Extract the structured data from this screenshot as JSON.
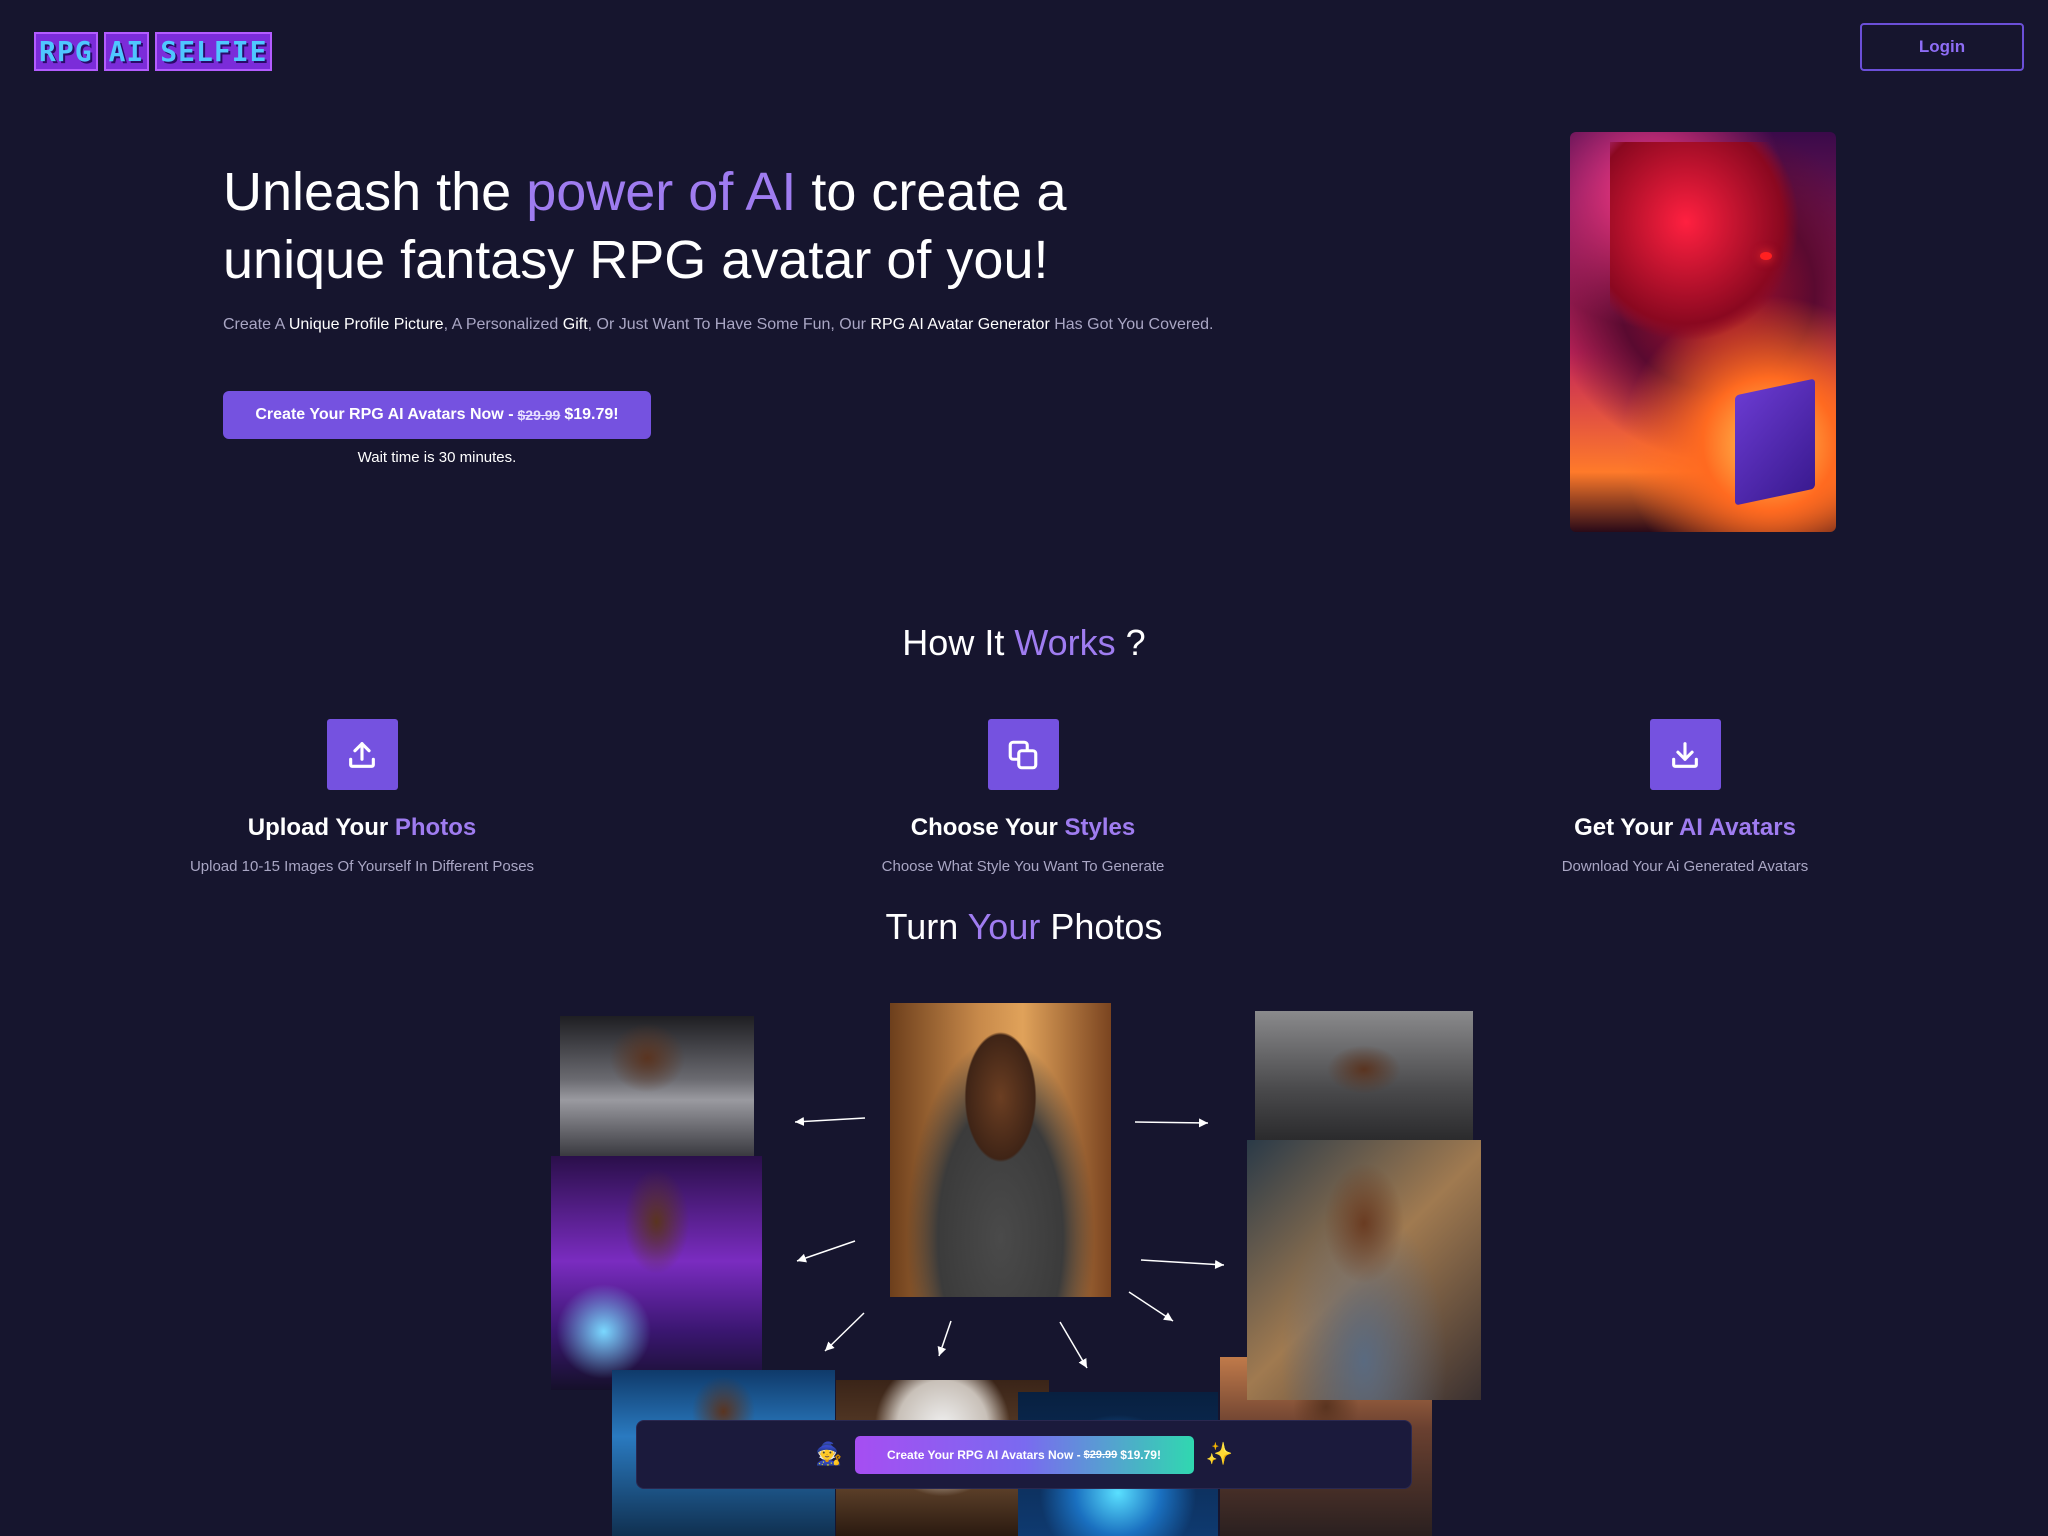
{
  "header": {
    "logo_words": [
      "RPG",
      "AI",
      "SELFIE"
    ],
    "login_label": "Login"
  },
  "hero": {
    "title_part1": "Unleash the ",
    "title_highlight": "power of AI",
    "title_part2": " to create a unique fantasy RPG avatar of you!",
    "subtitle": {
      "t1": "Create A ",
      "b1": "Unique Profile Picture",
      "t2": ", A Personalized ",
      "b2": "Gift",
      "t3": ", Or Just Want To Have Some Fun, Our ",
      "b3": "RPG AI Avatar Generator",
      "t4": " Has Got You Covered."
    },
    "cta_label": "Create Your RPG AI Avatars Now - ",
    "cta_old_price": "$29.99",
    "cta_new_price": "$19.79!",
    "wait_text": "Wait time is 30 minutes."
  },
  "how_it_works": {
    "title_part1": "How It ",
    "title_highlight": "Works",
    "title_part2": " ?",
    "steps": [
      {
        "title": "Upload Your ",
        "highlight": "Photos",
        "desc": "Upload 10-15 Images Of Yourself In Different Poses",
        "icon": "upload-icon"
      },
      {
        "title": "Choose Your ",
        "highlight": "Styles",
        "desc": "Choose What Style You Want To Generate",
        "icon": "copy-icon"
      },
      {
        "title": "Get Your ",
        "highlight": "AI Avatars",
        "desc": "Download Your Ai Generated Avatars",
        "icon": "download-icon"
      }
    ]
  },
  "turn": {
    "title_part1": "Turn ",
    "title_highlight": "Your",
    "title_part2": " Photos"
  },
  "sticky": {
    "emoji_left": "🧙",
    "emoji_right": "✨",
    "cta_label": "Create Your RPG AI Avatars Now - ",
    "cta_old_price": "$29.99",
    "cta_new_price": "$19.79!"
  },
  "colors": {
    "background": "#16152e",
    "accent": "#9f7cf0",
    "button": "#7552e0"
  }
}
